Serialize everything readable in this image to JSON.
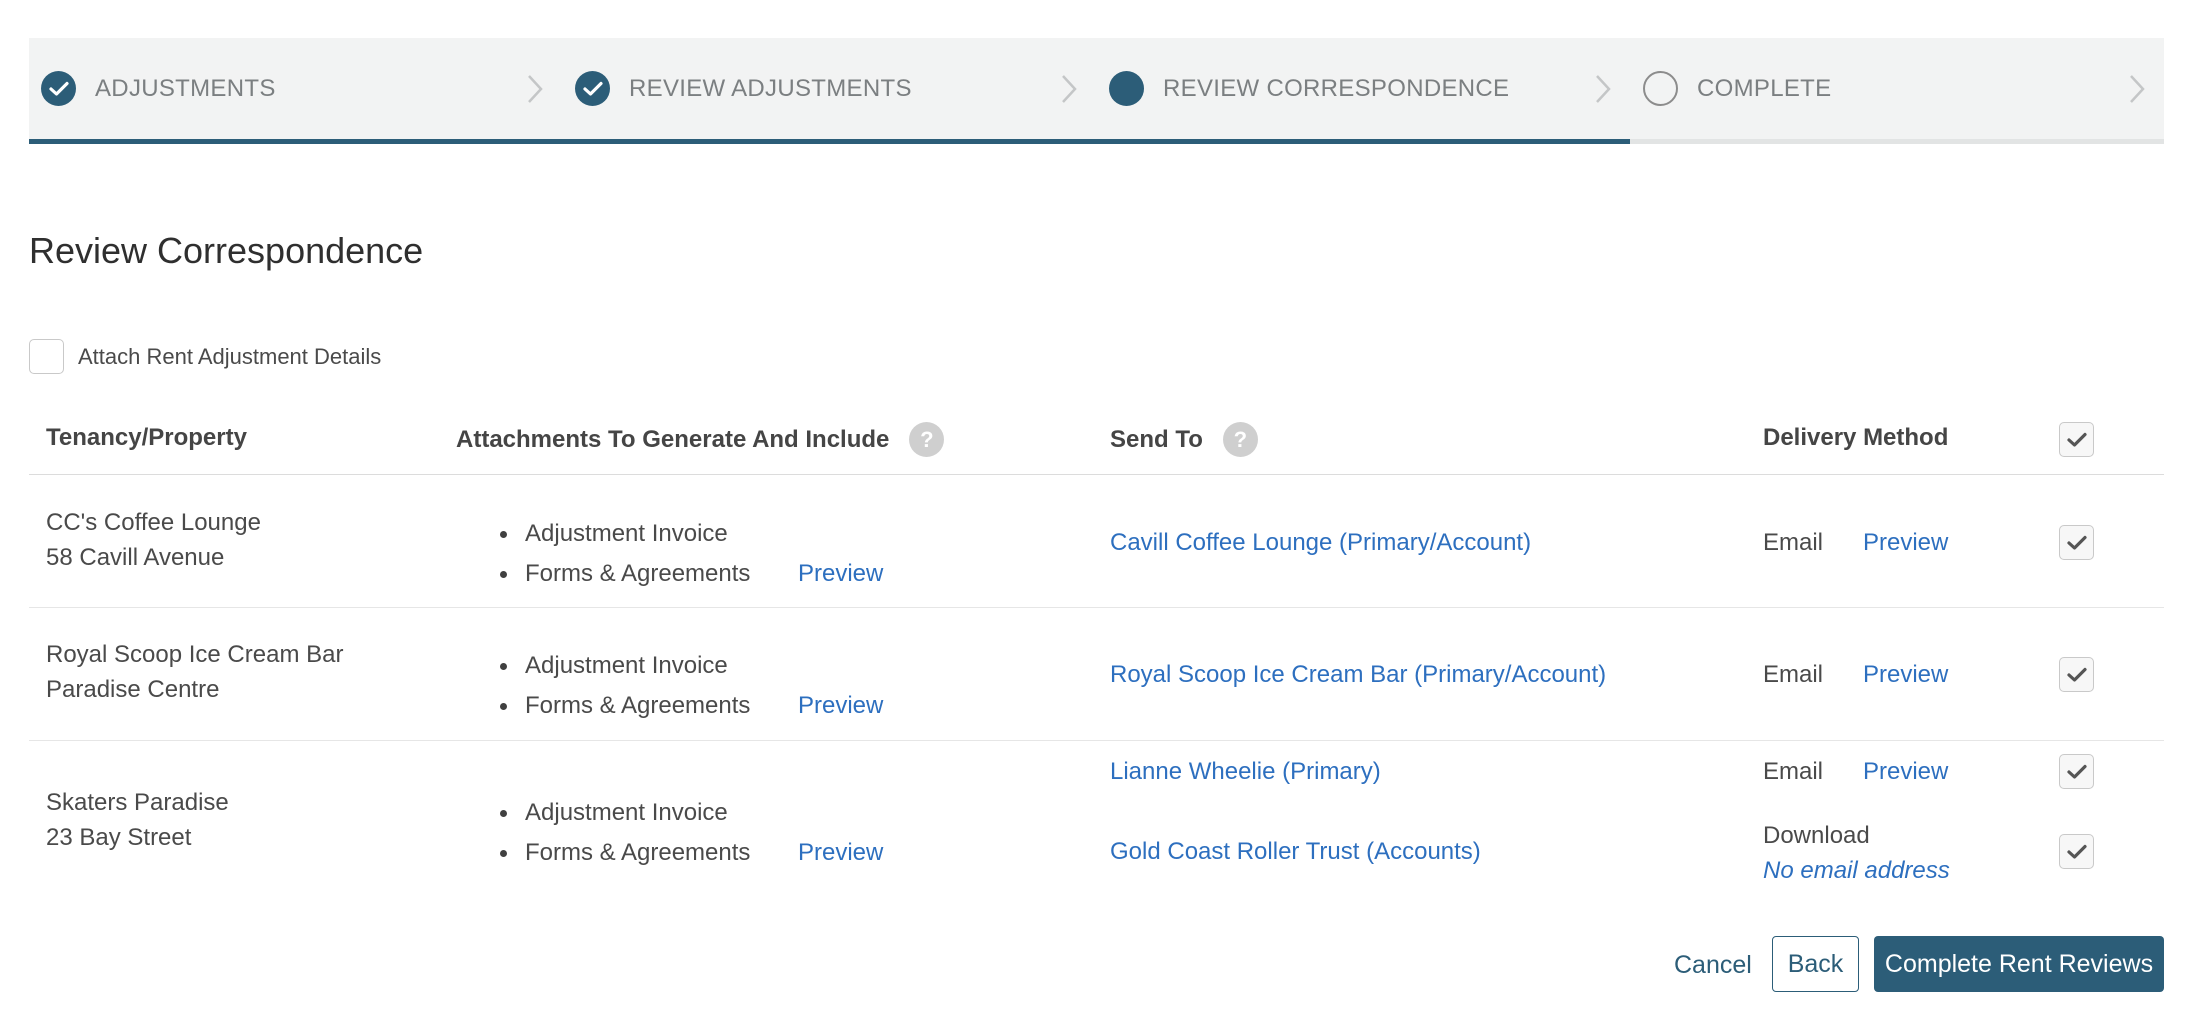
{
  "stepper": {
    "steps": [
      {
        "label": "ADJUSTMENTS",
        "status": "done"
      },
      {
        "label": "REVIEW ADJUSTMENTS",
        "status": "done"
      },
      {
        "label": "REVIEW CORRESPONDENCE",
        "status": "current"
      },
      {
        "label": "COMPLETE",
        "status": "todo"
      }
    ],
    "progress_fraction": 0.75
  },
  "page": {
    "title": "Review Correspondence",
    "attach_details_label": "Attach Rent Adjustment Details",
    "attach_details_checked": false
  },
  "table": {
    "headers": {
      "tenancy": "Tenancy/Property",
      "attachments": "Attachments To Generate And Include",
      "send_to": "Send To",
      "delivery": "Delivery Method",
      "help_glyph": "?"
    },
    "select_all_checked": true,
    "rows": [
      {
        "tenancy": "CC's Coffee Lounge",
        "property": "58 Cavill Avenue",
        "attachments": [
          "Adjustment Invoice",
          "Forms & Agreements"
        ],
        "attachments_preview": "Preview",
        "recipients": [
          {
            "name": "Cavill Coffee Lounge (Primary/Account)",
            "method": "Email",
            "preview": "Preview",
            "checked": true
          }
        ]
      },
      {
        "tenancy": "Royal Scoop Ice Cream Bar",
        "property": "Paradise Centre",
        "attachments": [
          "Adjustment Invoice",
          "Forms & Agreements"
        ],
        "attachments_preview": "Preview",
        "recipients": [
          {
            "name": "Royal Scoop Ice Cream Bar (Primary/Account)",
            "method": "Email",
            "preview": "Preview",
            "checked": true
          }
        ]
      },
      {
        "tenancy": "Skaters Paradise",
        "property": "23 Bay Street",
        "attachments": [
          "Adjustment Invoice",
          "Forms & Agreements"
        ],
        "attachments_preview": "Preview",
        "recipients": [
          {
            "name": "Lianne Wheelie (Primary)",
            "method": "Email",
            "preview": "Preview",
            "checked": true
          },
          {
            "name": "Gold Coast Roller Trust (Accounts)",
            "method": "Download",
            "note": "No email address",
            "checked": true
          }
        ]
      }
    ]
  },
  "actions": {
    "cancel": "Cancel",
    "back": "Back",
    "complete": "Complete Rent Reviews"
  },
  "colors": {
    "primary": "#2c5d78",
    "link": "#2d6fbf",
    "stepper_bg": "#f2f3f3"
  },
  "icons": {
    "step_done": "check-circle-icon",
    "step_current": "filled-circle-icon",
    "step_todo": "empty-circle-icon",
    "step_separator": "chevron-right-icon",
    "help": "question-icon",
    "checkbox": "checkmark-icon"
  }
}
